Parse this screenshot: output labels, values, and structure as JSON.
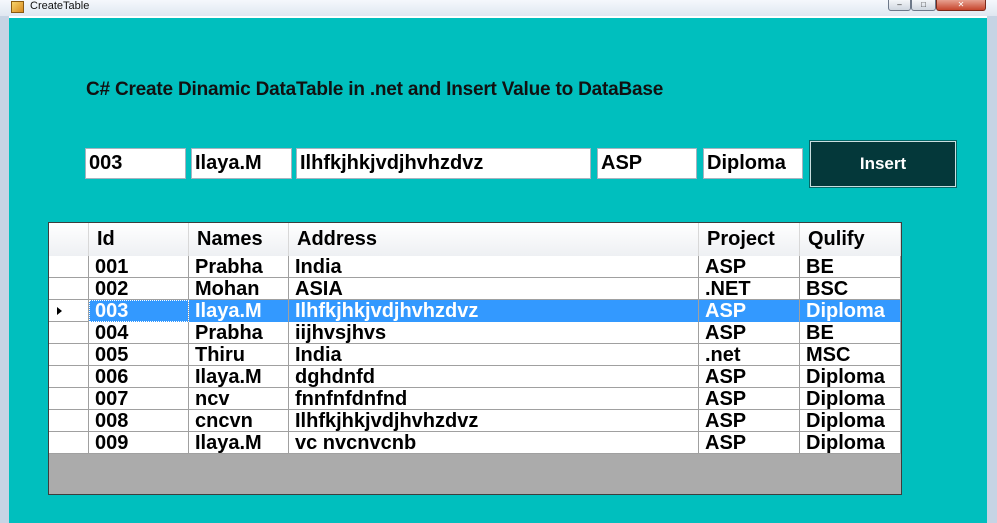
{
  "window": {
    "title": "CreateTable",
    "buttons": {
      "minimize": "–",
      "maximize": "□",
      "close": "✕"
    }
  },
  "heading": "C# Create Dinamic DataTable in .net and Insert Value to DataBase",
  "inputs": {
    "id": "003",
    "name": "Ilaya.M",
    "address": "Ilhfkjhkjvdjhvhzdvz",
    "project": "ASP",
    "qualify": "Diploma"
  },
  "insert_button": "Insert",
  "grid": {
    "columns": [
      "Id",
      "Names",
      "Address",
      "Project",
      "Qulify"
    ],
    "selected_index": 2,
    "rows": [
      [
        "001",
        "Prabha",
        "India",
        "ASP",
        "BE"
      ],
      [
        "002",
        "Mohan",
        "ASIA",
        ".NET",
        "BSC"
      ],
      [
        "003",
        "Ilaya.M",
        "Ilhfkjhkjvdjhvhzdvz",
        "ASP",
        "Diploma"
      ],
      [
        "004",
        "Prabha",
        "iijhvsjhvs",
        "ASP",
        "BE"
      ],
      [
        "005",
        "Thiru",
        "India",
        ".net",
        "MSC"
      ],
      [
        "006",
        "Ilaya.M",
        "dghdnfd",
        "ASP",
        "Diploma"
      ],
      [
        "007",
        "ncv",
        "fnnfnfdnfnd",
        "ASP",
        "Diploma"
      ],
      [
        "008",
        "cncvn",
        "Ilhfkjhkjvdjhvhzdvz",
        "ASP",
        "Diploma"
      ],
      [
        "009",
        "Ilaya.M",
        "vc nvcnvcnb",
        "ASP",
        "Diploma"
      ]
    ]
  },
  "colors": {
    "form_background": "#00bfbe",
    "button_background": "#04383a",
    "selection": "#3399ff"
  },
  "icons": {
    "app": "form-icon",
    "current_row": "row-pointer-icon"
  }
}
